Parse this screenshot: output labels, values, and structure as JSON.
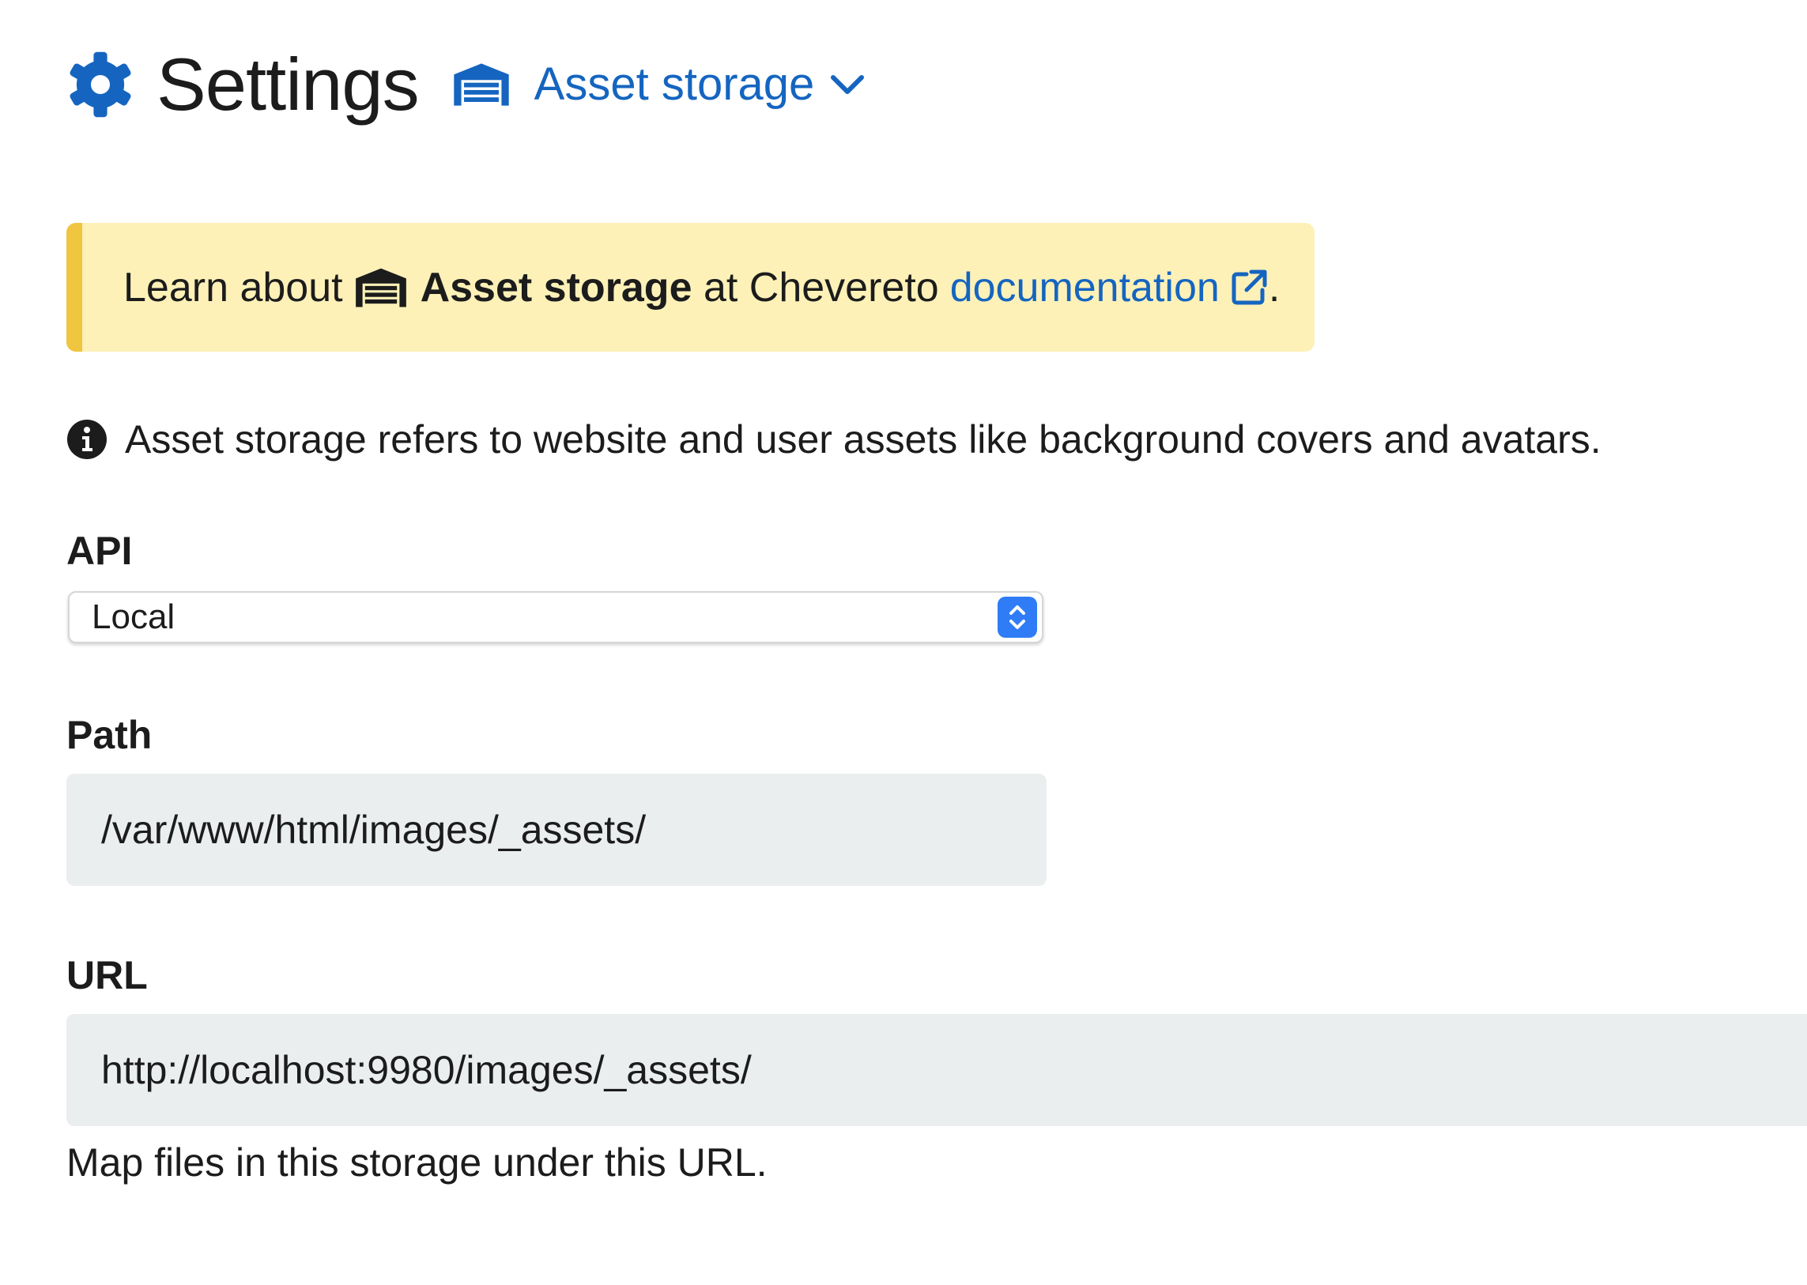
{
  "header": {
    "title": "Settings",
    "section_label": "Asset storage",
    "icons": {
      "title": "gear-icon",
      "section": "warehouse-icon",
      "dropdown": "chevron-down-icon"
    }
  },
  "notice": {
    "prefix": "Learn about",
    "feature": "Asset storage",
    "middle": "at Chevereto",
    "link_text": "documentation",
    "suffix": ".",
    "icons": {
      "feature": "warehouse-icon",
      "link": "external-link-icon"
    }
  },
  "info": {
    "text": "Asset storage refers to website and user assets like background covers and avatars.",
    "icon": "info-circle-icon"
  },
  "fields": {
    "api": {
      "label": "API",
      "value": "Local"
    },
    "path": {
      "label": "Path",
      "value": "/var/www/html/images/_assets/"
    },
    "url": {
      "label": "URL",
      "value": "http://localhost:9980/images/_assets/",
      "help": "Map files in this storage under this URL."
    }
  },
  "colors": {
    "accent": "#1565c0",
    "notice_bg": "#fdf1b8",
    "notice_border": "#f0c53f",
    "input_bg": "#ebeeef",
    "select_button": "#2f7cf6"
  }
}
